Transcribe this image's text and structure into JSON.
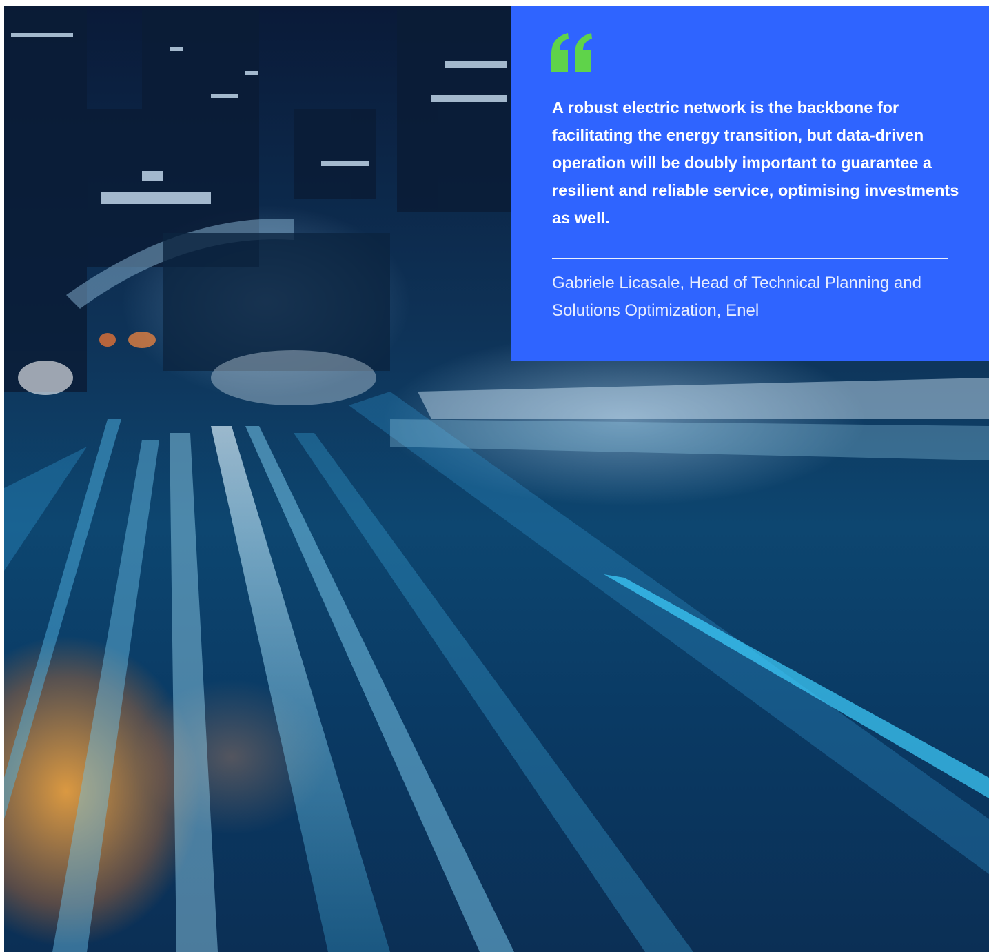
{
  "quote": {
    "icon": "quote-mark-icon",
    "text": "A robust electric network is the backbone for facilitating the energy transition, but data-driven operation will be doubly important to guarantee a resilient and reliable service, optimising investments as well.",
    "attribution": "Gabriele Licasale, Head of Technical Planning and Solutions Optimization, Enel"
  },
  "colors": {
    "quote_background": "#2f64ff",
    "quote_mark": "#5fd34a",
    "text": "#ffffff"
  }
}
